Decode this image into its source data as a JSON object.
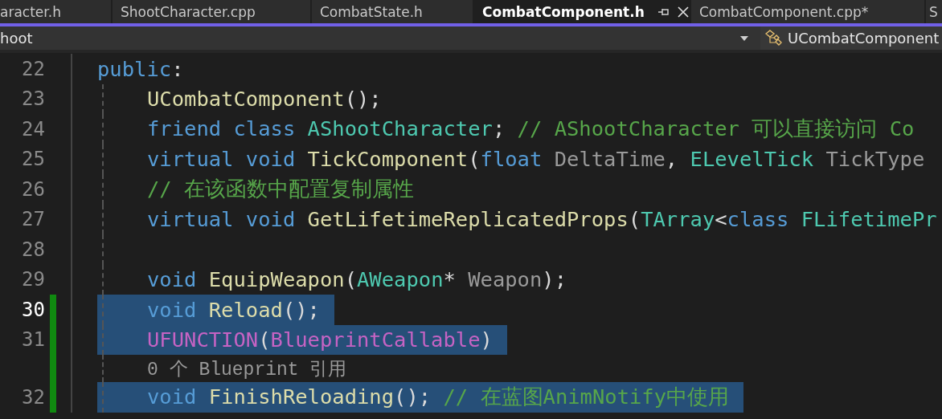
{
  "tabs": [
    {
      "label": "aracter.h",
      "selected": false
    },
    {
      "label": "ShootCharacter.cpp",
      "selected": false
    },
    {
      "label": "CombatState.h",
      "selected": false
    },
    {
      "label": "CombatComponent.h",
      "selected": true,
      "pinnable": true,
      "closable": true
    },
    {
      "label": "CombatComponent.cpp*",
      "selected": false
    },
    {
      "label": "S",
      "selected": false
    }
  ],
  "navigation": {
    "project": "hoot",
    "member": "UCombatComponent"
  },
  "lines": [
    {
      "kind": "code",
      "number": "22",
      "indented": false,
      "current": false,
      "changed": false,
      "selected": false,
      "tokens": [
        {
          "kind": "keyword",
          "text": "public"
        },
        {
          "kind": "plain",
          "text": ":"
        }
      ]
    },
    {
      "kind": "code",
      "number": "23",
      "indented": true,
      "current": false,
      "changed": false,
      "selected": false,
      "tokens": [
        {
          "kind": "function",
          "text": "UCombatComponent"
        },
        {
          "kind": "plain",
          "text": "();"
        }
      ]
    },
    {
      "kind": "code",
      "number": "24",
      "indented": true,
      "current": false,
      "changed": false,
      "selected": false,
      "tokens": [
        {
          "kind": "keyword",
          "text": "friend class "
        },
        {
          "kind": "type",
          "text": "AShootCharacter"
        },
        {
          "kind": "plain",
          "text": "; "
        },
        {
          "kind": "comment",
          "text": "// AShootCharacter 可以直接访问 Co"
        }
      ]
    },
    {
      "kind": "code",
      "number": "25",
      "indented": true,
      "current": false,
      "changed": false,
      "selected": false,
      "tokens": [
        {
          "kind": "keyword",
          "text": "virtual void "
        },
        {
          "kind": "function",
          "text": "TickComponent"
        },
        {
          "kind": "plain",
          "text": "("
        },
        {
          "kind": "keyword",
          "text": "float "
        },
        {
          "kind": "param",
          "text": "DeltaTime"
        },
        {
          "kind": "plain",
          "text": ", "
        },
        {
          "kind": "type",
          "text": "ELevelTick "
        },
        {
          "kind": "param",
          "text": "TickType"
        }
      ]
    },
    {
      "kind": "code",
      "number": "26",
      "indented": true,
      "current": false,
      "changed": false,
      "selected": false,
      "tokens": [
        {
          "kind": "comment",
          "text": "// 在该函数中配置复制属性"
        }
      ]
    },
    {
      "kind": "code",
      "number": "27",
      "indented": true,
      "current": false,
      "changed": false,
      "selected": false,
      "tokens": [
        {
          "kind": "keyword",
          "text": "virtual void "
        },
        {
          "kind": "function",
          "text": "GetLifetimeReplicatedProps"
        },
        {
          "kind": "plain",
          "text": "("
        },
        {
          "kind": "type",
          "text": "TArray"
        },
        {
          "kind": "plain",
          "text": "<"
        },
        {
          "kind": "keyword",
          "text": "class "
        },
        {
          "kind": "type",
          "text": "FLifetimePr"
        }
      ]
    },
    {
      "kind": "code",
      "number": "28",
      "indented": true,
      "current": false,
      "changed": false,
      "selected": false
    },
    {
      "kind": "code",
      "number": "29",
      "indented": true,
      "current": false,
      "changed": false,
      "selected": false,
      "tokens": [
        {
          "kind": "keyword",
          "text": "void "
        },
        {
          "kind": "function",
          "text": "EquipWeapon"
        },
        {
          "kind": "plain",
          "text": "("
        },
        {
          "kind": "type",
          "text": "AWeapon"
        },
        {
          "kind": "plain",
          "text": "* "
        },
        {
          "kind": "param",
          "text": "Weapon"
        },
        {
          "kind": "plain",
          "text": ");"
        }
      ]
    },
    {
      "kind": "code",
      "number": "30",
      "indented": true,
      "current": true,
      "changed": true,
      "selected": true,
      "tokens": [
        {
          "kind": "keyword",
          "text": "void "
        },
        {
          "kind": "function",
          "text": "Reload"
        },
        {
          "kind": "plain",
          "text": "();"
        }
      ]
    },
    {
      "kind": "code",
      "number": "31",
      "indented": true,
      "current": false,
      "changed": true,
      "selected": true,
      "tokens": [
        {
          "kind": "macro",
          "text": "UFUNCTION"
        },
        {
          "kind": "plain",
          "text": "("
        },
        {
          "kind": "macro",
          "text": "BlueprintCallable"
        },
        {
          "kind": "plain",
          "text": ")"
        }
      ]
    },
    {
      "kind": "codelens",
      "text": "0 个 Blueprint 引用",
      "changed": true
    },
    {
      "kind": "code",
      "number": "32",
      "indented": true,
      "current": false,
      "changed": true,
      "selected": true,
      "tokens": [
        {
          "kind": "keyword",
          "text": "void "
        },
        {
          "kind": "function",
          "text": "FinishReloading"
        },
        {
          "kind": "plain",
          "text": "(); "
        },
        {
          "kind": "comment",
          "text": "// 在蓝图AnimNotify中使用"
        }
      ]
    }
  ]
}
